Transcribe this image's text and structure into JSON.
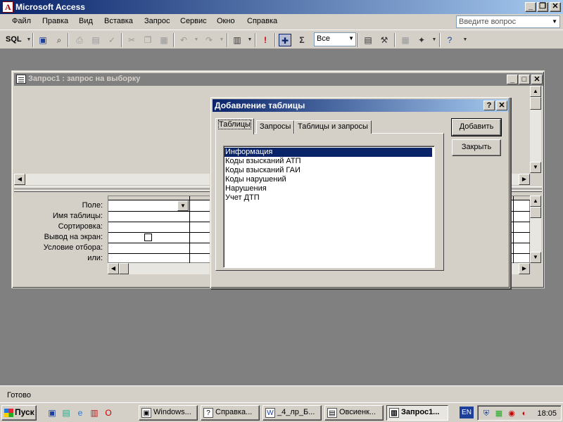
{
  "app": {
    "title": "Microsoft Access"
  },
  "menu": {
    "items": [
      "Файл",
      "Правка",
      "Вид",
      "Вставка",
      "Запрос",
      "Сервис",
      "Окно",
      "Справка"
    ],
    "help_placeholder": "Введите вопрос"
  },
  "toolbar": {
    "sql_label": "SQL",
    "sigma_label": "Σ",
    "top_values": "Все"
  },
  "query_window": {
    "title": "Запрос1 : запрос на выборку",
    "row_labels": [
      "Поле:",
      "Имя таблицы:",
      "Сортировка:",
      "Вывод на экран:",
      "Условие отбора:",
      "или:"
    ]
  },
  "dialog": {
    "title": "Добавление таблицы",
    "help_btn": "?",
    "close_btn": "✕",
    "tabs": [
      "Таблицы",
      "Запросы",
      "Таблицы и запросы"
    ],
    "active_tab": "Таблицы",
    "tables": [
      "Информация",
      "Коды взысканий АТП",
      "Коды взысканий ГАИ",
      "Коды нарушений",
      "Нарушения",
      "Учет ДТП"
    ],
    "selected": "Информация",
    "add_button": "Добавить",
    "close_button": "Закрыть"
  },
  "status": {
    "text": "Готово"
  },
  "taskbar": {
    "start": "Пуск",
    "tasks": [
      "Windows...",
      "Справка...",
      "_4_лр_Б...",
      "Овсиенк...",
      "Запрос1..."
    ],
    "active_task": "Запрос1...",
    "language": "EN",
    "clock": "18:05"
  },
  "colors": {
    "title_active": "#0a246a",
    "title_inactive": "#808080",
    "face": "#d4d0c8",
    "selection": "#0a246a"
  }
}
